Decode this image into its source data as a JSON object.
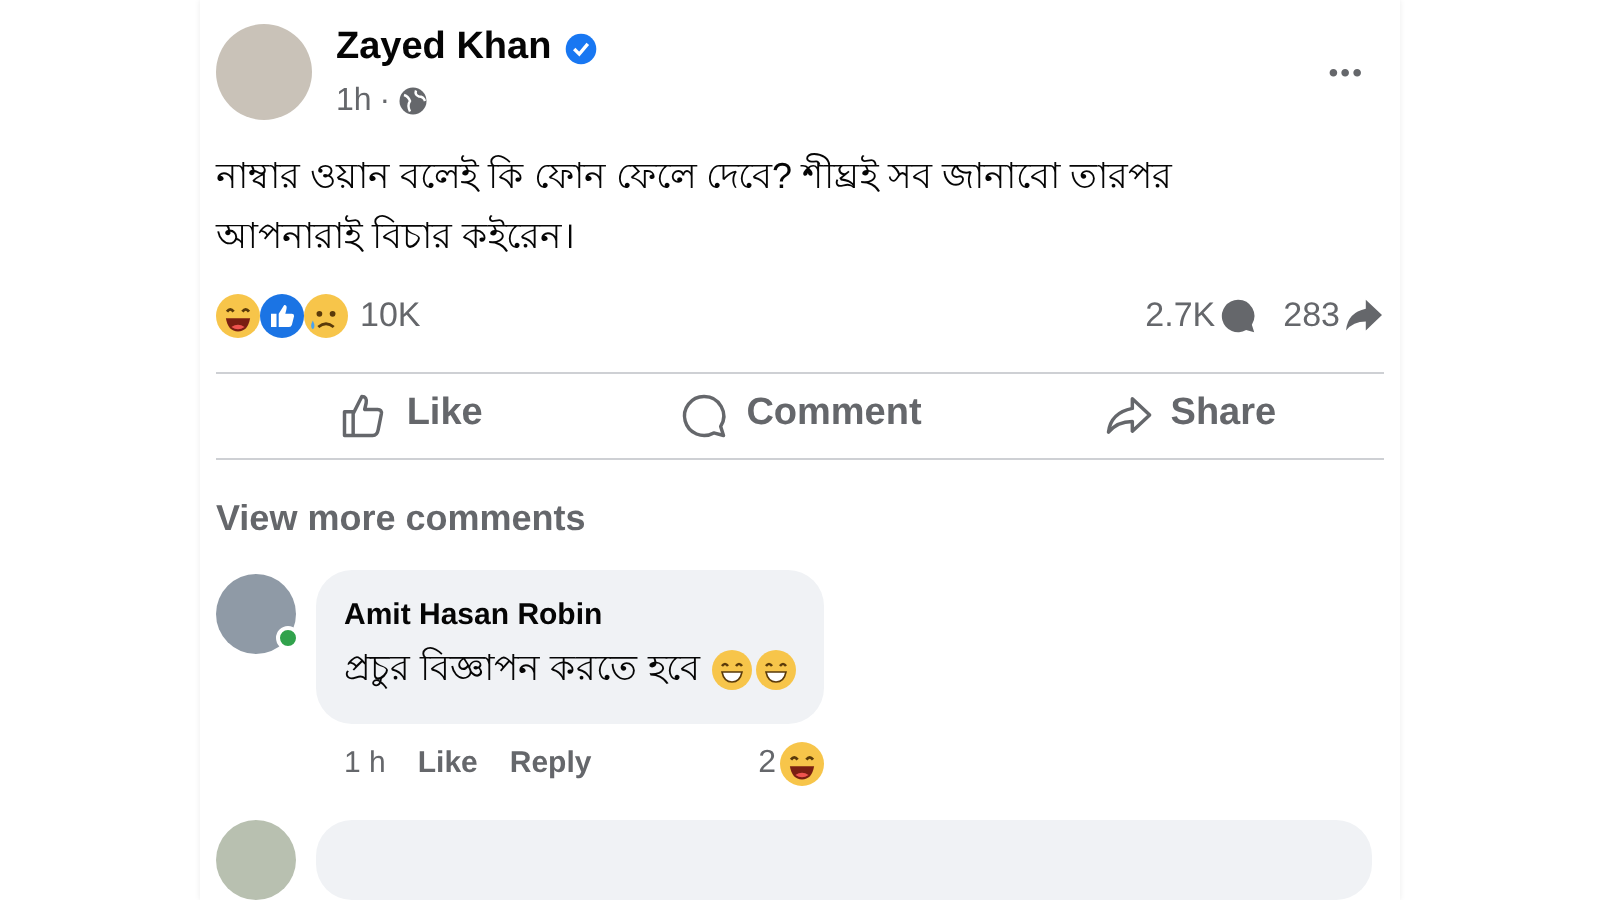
{
  "post": {
    "author": "Zayed Khan",
    "verified": true,
    "time": "1h",
    "separator": "·",
    "more": "•••",
    "text": "নাম্বার ওয়ান বলেই কি ফোন ফেলে দেবে? শীঘ্রই সব জানাবো তারপর আপনারাই বিচার কইরেন।"
  },
  "stats": {
    "reactions": "10K",
    "comments": "2.7K",
    "shares": "283"
  },
  "actions": [
    {
      "kind": "like",
      "label": "Like"
    },
    {
      "kind": "comment",
      "label": "Comment"
    },
    {
      "kind": "share",
      "label": "Share"
    }
  ],
  "view_more": "View more comments",
  "comments": [
    {
      "author": "Amit Hasan Robin",
      "online": true,
      "text": "প্রচুর বিজ্ঞাপন করতে হবে",
      "time": "1 h",
      "like": "Like",
      "reply": "Reply",
      "reaction_count": "2"
    }
  ]
}
